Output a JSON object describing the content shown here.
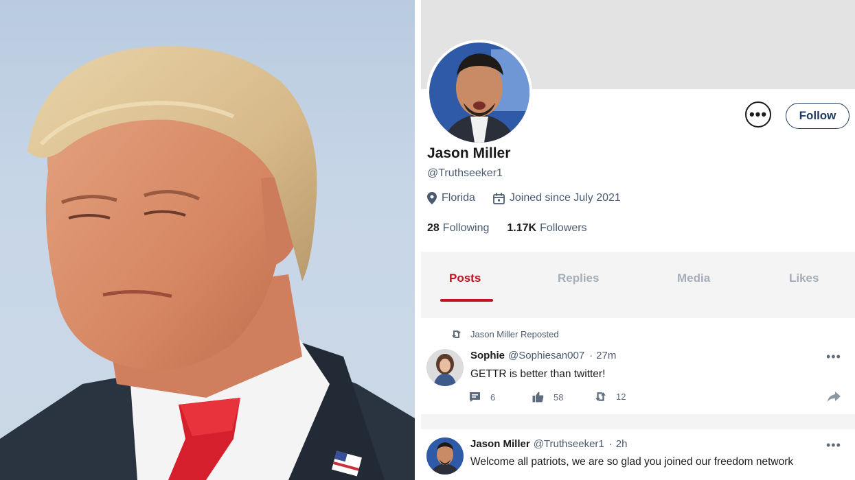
{
  "profile": {
    "display_name": "Jason Miller",
    "handle": "@Truthseeker1",
    "location": "Florida",
    "joined": "Joined since July 2021",
    "following_count": "28",
    "following_label": "Following",
    "followers_count": "1.17K",
    "followers_label": "Followers",
    "follow_label": "Follow",
    "more_label": "•••"
  },
  "tabs": [
    {
      "label": "Posts",
      "active": true
    },
    {
      "label": "Replies",
      "active": false
    },
    {
      "label": "Media",
      "active": false
    },
    {
      "label": "Likes",
      "active": false
    }
  ],
  "posts": [
    {
      "repost_text": "Jason Miller Reposted",
      "author": "Sophie",
      "handle": "@Sophiesan007",
      "time": "27m",
      "text": "GETTR is better than twitter!",
      "comments": "6",
      "likes": "58",
      "reposts": "12",
      "menu": "•••"
    },
    {
      "author": "Jason Miller",
      "handle": "@Truthseeker1",
      "time": "2h",
      "text": "Welcome all patriots, we are so glad you joined our freedom network",
      "menu": "•••"
    }
  ],
  "colors": {
    "accent_red": "#c1121f",
    "follow_navy": "#1f3a5a",
    "muted_text": "#4a5a6f",
    "tab_inactive": "#a4adb8",
    "cover_gray": "#e3e3e3",
    "tabs_bg": "#f4f4f4"
  },
  "icons": {
    "location": "map-pin-icon",
    "joined": "calendar-icon",
    "repost": "repost-icon",
    "comment": "comment-icon",
    "like": "thumbs-up-icon",
    "share": "share-arrow-icon"
  }
}
